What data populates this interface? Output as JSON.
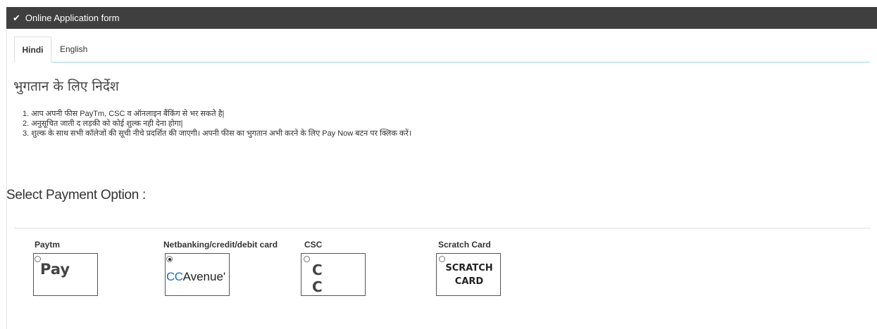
{
  "header": {
    "check_icon": "✔",
    "title": "Online Application form"
  },
  "tabs": [
    {
      "label": "Hindi",
      "active": true
    },
    {
      "label": "English",
      "active": false
    }
  ],
  "instructions": {
    "title": "भुगतान के लिए निर्देश",
    "steps": [
      "1. आप अपनी फीस PayTm, CSC व ऑनलाइन बैंकिंग से भर सकते है|",
      "2. अनुसूचित जाती द लड़की को कोई शुल्क नही देना होगा|",
      "3. शुल्क के साथ सभी कॉलेजों की सूची नीचे प्रदर्शित की जाएगी। अपनी फीस का भुगतान अभी करने के लिए Pay Now बटन पर क्लिक करें।"
    ]
  },
  "payment": {
    "heading": "Select Payment Option :",
    "options": [
      {
        "label": "Paytm",
        "logo_text": "Pay",
        "selected": false
      },
      {
        "label": "Netbanking/credit/debit card",
        "logo_cc": "CC",
        "logo_rest": "Avenue'",
        "selected": true
      },
      {
        "label": "CSC",
        "logo_text": "C C",
        "selected": false
      },
      {
        "label": "Scratch Card",
        "logo_line1": "SCRATCH",
        "logo_line2": "CARD",
        "selected": false
      }
    ]
  },
  "colors": {
    "header_bg": "#3f3f3f",
    "tab_underline": "#9fd3e8",
    "ccavenue_blue": "#1b6fc4"
  }
}
